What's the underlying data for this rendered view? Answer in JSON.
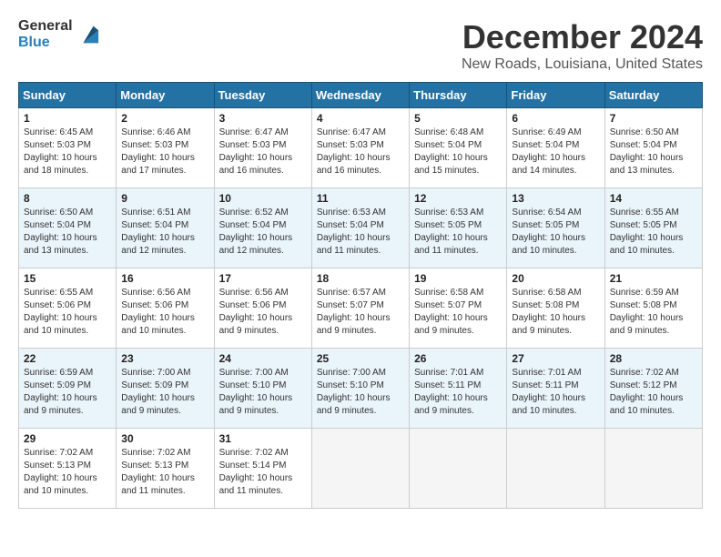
{
  "header": {
    "logo_general": "General",
    "logo_blue": "Blue",
    "month_title": "December 2024",
    "location": "New Roads, Louisiana, United States"
  },
  "calendar": {
    "days_of_week": [
      "Sunday",
      "Monday",
      "Tuesday",
      "Wednesday",
      "Thursday",
      "Friday",
      "Saturday"
    ],
    "weeks": [
      [
        {
          "day": "",
          "empty": true
        },
        {
          "day": "",
          "empty": true
        },
        {
          "day": "",
          "empty": true
        },
        {
          "day": "",
          "empty": true
        },
        {
          "day": "",
          "empty": true
        },
        {
          "day": "",
          "empty": true
        },
        {
          "day": "",
          "empty": true
        }
      ],
      [
        {
          "num": "1",
          "sunrise": "6:45 AM",
          "sunset": "5:03 PM",
          "daylight": "10 hours and 18 minutes."
        },
        {
          "num": "2",
          "sunrise": "6:46 AM",
          "sunset": "5:03 PM",
          "daylight": "10 hours and 17 minutes."
        },
        {
          "num": "3",
          "sunrise": "6:47 AM",
          "sunset": "5:03 PM",
          "daylight": "10 hours and 16 minutes."
        },
        {
          "num": "4",
          "sunrise": "6:47 AM",
          "sunset": "5:03 PM",
          "daylight": "10 hours and 16 minutes."
        },
        {
          "num": "5",
          "sunrise": "6:48 AM",
          "sunset": "5:04 PM",
          "daylight": "10 hours and 15 minutes."
        },
        {
          "num": "6",
          "sunrise": "6:49 AM",
          "sunset": "5:04 PM",
          "daylight": "10 hours and 14 minutes."
        },
        {
          "num": "7",
          "sunrise": "6:50 AM",
          "sunset": "5:04 PM",
          "daylight": "10 hours and 13 minutes."
        }
      ],
      [
        {
          "num": "8",
          "sunrise": "6:50 AM",
          "sunset": "5:04 PM",
          "daylight": "10 hours and 13 minutes."
        },
        {
          "num": "9",
          "sunrise": "6:51 AM",
          "sunset": "5:04 PM",
          "daylight": "10 hours and 12 minutes."
        },
        {
          "num": "10",
          "sunrise": "6:52 AM",
          "sunset": "5:04 PM",
          "daylight": "10 hours and 12 minutes."
        },
        {
          "num": "11",
          "sunrise": "6:53 AM",
          "sunset": "5:04 PM",
          "daylight": "10 hours and 11 minutes."
        },
        {
          "num": "12",
          "sunrise": "6:53 AM",
          "sunset": "5:05 PM",
          "daylight": "10 hours and 11 minutes."
        },
        {
          "num": "13",
          "sunrise": "6:54 AM",
          "sunset": "5:05 PM",
          "daylight": "10 hours and 10 minutes."
        },
        {
          "num": "14",
          "sunrise": "6:55 AM",
          "sunset": "5:05 PM",
          "daylight": "10 hours and 10 minutes."
        }
      ],
      [
        {
          "num": "15",
          "sunrise": "6:55 AM",
          "sunset": "5:06 PM",
          "daylight": "10 hours and 10 minutes."
        },
        {
          "num": "16",
          "sunrise": "6:56 AM",
          "sunset": "5:06 PM",
          "daylight": "10 hours and 10 minutes."
        },
        {
          "num": "17",
          "sunrise": "6:56 AM",
          "sunset": "5:06 PM",
          "daylight": "10 hours and 9 minutes."
        },
        {
          "num": "18",
          "sunrise": "6:57 AM",
          "sunset": "5:07 PM",
          "daylight": "10 hours and 9 minutes."
        },
        {
          "num": "19",
          "sunrise": "6:58 AM",
          "sunset": "5:07 PM",
          "daylight": "10 hours and 9 minutes."
        },
        {
          "num": "20",
          "sunrise": "6:58 AM",
          "sunset": "5:08 PM",
          "daylight": "10 hours and 9 minutes."
        },
        {
          "num": "21",
          "sunrise": "6:59 AM",
          "sunset": "5:08 PM",
          "daylight": "10 hours and 9 minutes."
        }
      ],
      [
        {
          "num": "22",
          "sunrise": "6:59 AM",
          "sunset": "5:09 PM",
          "daylight": "10 hours and 9 minutes."
        },
        {
          "num": "23",
          "sunrise": "7:00 AM",
          "sunset": "5:09 PM",
          "daylight": "10 hours and 9 minutes."
        },
        {
          "num": "24",
          "sunrise": "7:00 AM",
          "sunset": "5:10 PM",
          "daylight": "10 hours and 9 minutes."
        },
        {
          "num": "25",
          "sunrise": "7:00 AM",
          "sunset": "5:10 PM",
          "daylight": "10 hours and 9 minutes."
        },
        {
          "num": "26",
          "sunrise": "7:01 AM",
          "sunset": "5:11 PM",
          "daylight": "10 hours and 9 minutes."
        },
        {
          "num": "27",
          "sunrise": "7:01 AM",
          "sunset": "5:11 PM",
          "daylight": "10 hours and 10 minutes."
        },
        {
          "num": "28",
          "sunrise": "7:02 AM",
          "sunset": "5:12 PM",
          "daylight": "10 hours and 10 minutes."
        }
      ],
      [
        {
          "num": "29",
          "sunrise": "7:02 AM",
          "sunset": "5:13 PM",
          "daylight": "10 hours and 10 minutes."
        },
        {
          "num": "30",
          "sunrise": "7:02 AM",
          "sunset": "5:13 PM",
          "daylight": "10 hours and 11 minutes."
        },
        {
          "num": "31",
          "sunrise": "7:02 AM",
          "sunset": "5:14 PM",
          "daylight": "10 hours and 11 minutes."
        },
        {
          "day": "",
          "empty": true
        },
        {
          "day": "",
          "empty": true
        },
        {
          "day": "",
          "empty": true
        },
        {
          "day": "",
          "empty": true
        }
      ]
    ]
  }
}
